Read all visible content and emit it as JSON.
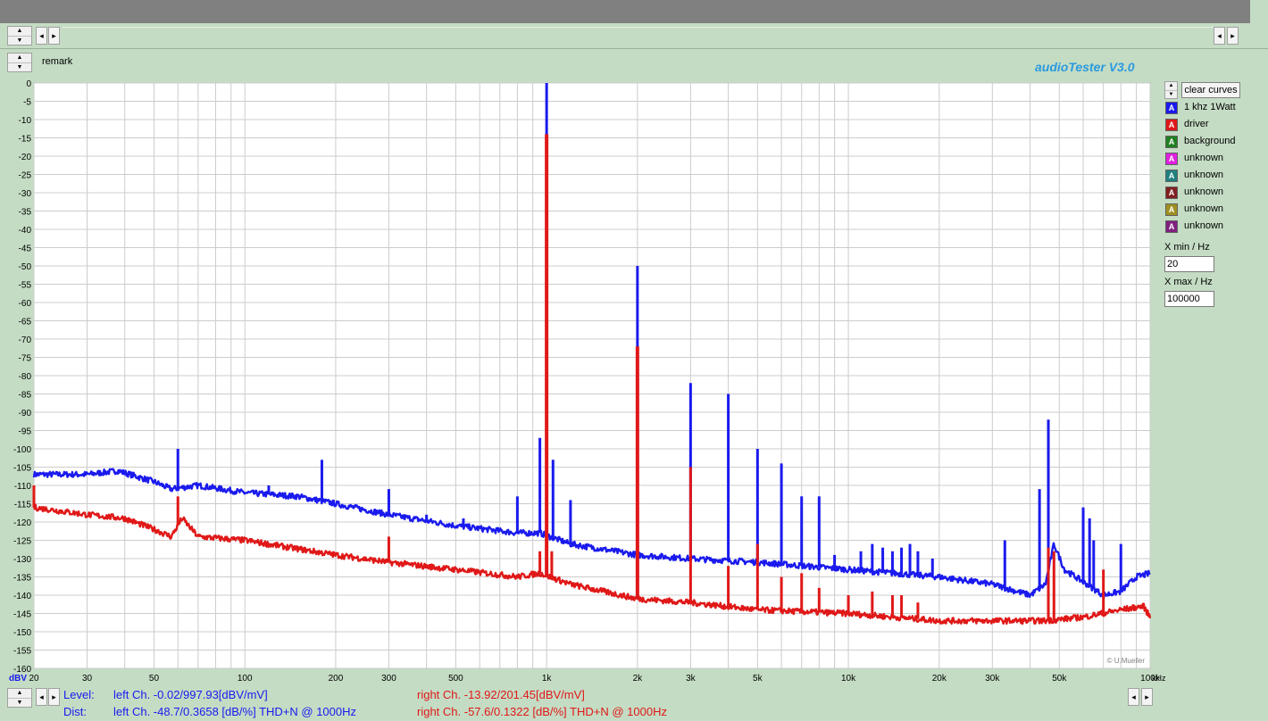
{
  "app": {
    "title": "audioTester  V3.0",
    "remark_label": "remark",
    "copyright": "© U.Mueller"
  },
  "controls": {
    "clear_label": "clear curves",
    "xmin_label": "X min / Hz",
    "xmin_value": "20",
    "xmax_label": "X max / Hz",
    "xmax_value": "100000"
  },
  "legend": [
    {
      "name": "1 khz 1Watt",
      "color": "#1a1aee"
    },
    {
      "name": "driver",
      "color": "#e01818"
    },
    {
      "name": "background",
      "color": "#208020"
    },
    {
      "name": "unknown",
      "color": "#e020e0"
    },
    {
      "name": "unknown",
      "color": "#208080"
    },
    {
      "name": "unknown",
      "color": "#802020"
    },
    {
      "name": "unknown",
      "color": "#a09020"
    },
    {
      "name": "unknown",
      "color": "#802080"
    }
  ],
  "status": {
    "level_label": "Level:",
    "level_left": "left Ch. -0.02/997.93[dBV/mV]",
    "level_right": "right Ch. -13.92/201.45[dBV/mV]",
    "dist_label": "Dist:",
    "dist_left": "left Ch. -48.7/0.3658 [dB/%] THD+N  @ 1000Hz",
    "dist_right": "right Ch. -57.6/0.1322 [dB/%] THD+N  @ 1000Hz"
  },
  "chart_data": {
    "type": "line",
    "x_scale": "log",
    "xlim": [
      20,
      100000
    ],
    "ylim": [
      -160,
      0
    ],
    "grid": true,
    "ylabel": "dBV",
    "xlabel": "kHz",
    "y_ticks": [
      "0",
      "-5",
      "-10",
      "-15",
      "-20",
      "-25",
      "-30",
      "-35",
      "-40",
      "-45",
      "-50",
      "-55",
      "-60",
      "-65",
      "-70",
      "-75",
      "-80",
      "-85",
      "-90",
      "-95",
      "-100",
      "-105",
      "-110",
      "-115",
      "-120",
      "-125",
      "-130",
      "-135",
      "-140",
      "-145",
      "-150",
      "-155",
      "-160"
    ],
    "x_ticks": [
      {
        "v": 20,
        "label": "20"
      },
      {
        "v": 30,
        "label": "30"
      },
      {
        "v": 50,
        "label": "50"
      },
      {
        "v": 100,
        "label": "100"
      },
      {
        "v": 200,
        "label": "200"
      },
      {
        "v": 300,
        "label": "300"
      },
      {
        "v": 500,
        "label": "500"
      },
      {
        "v": 1000,
        "label": "1k"
      },
      {
        "v": 2000,
        "label": "2k"
      },
      {
        "v": 3000,
        "label": "3k"
      },
      {
        "v": 5000,
        "label": "5k"
      },
      {
        "v": 10000,
        "label": "10k"
      },
      {
        "v": 20000,
        "label": "20k"
      },
      {
        "v": 30000,
        "label": "30k"
      },
      {
        "v": 50000,
        "label": "50k"
      },
      {
        "v": 100000,
        "label": "100k"
      }
    ],
    "series": [
      {
        "name": "1 khz 1Watt",
        "color": "#1a1aee",
        "baseline": [
          [
            20,
            -107
          ],
          [
            30,
            -107
          ],
          [
            38,
            -106
          ],
          [
            50,
            -109
          ],
          [
            57,
            -111
          ],
          [
            70,
            -110
          ],
          [
            100,
            -112
          ],
          [
            150,
            -113
          ],
          [
            200,
            -115
          ],
          [
            300,
            -118
          ],
          [
            500,
            -121
          ],
          [
            800,
            -123
          ],
          [
            950,
            -123
          ],
          [
            1200,
            -126
          ],
          [
            2000,
            -129
          ],
          [
            3000,
            -130
          ],
          [
            5000,
            -131
          ],
          [
            10000,
            -133
          ],
          [
            20000,
            -135
          ],
          [
            30000,
            -137
          ],
          [
            40000,
            -140
          ],
          [
            45000,
            -137
          ],
          [
            48000,
            -126
          ],
          [
            52000,
            -133
          ],
          [
            70000,
            -140
          ],
          [
            80000,
            -139
          ],
          [
            90000,
            -135
          ],
          [
            100000,
            -134
          ]
        ],
        "peaks": [
          [
            60,
            -100
          ],
          [
            120,
            -110
          ],
          [
            180,
            -103
          ],
          [
            300,
            -111
          ],
          [
            400,
            -118
          ],
          [
            530,
            -119
          ],
          [
            800,
            -113
          ],
          [
            950,
            -97
          ],
          [
            1000,
            0
          ],
          [
            1050,
            -103
          ],
          [
            1200,
            -114
          ],
          [
            2000,
            -50
          ],
          [
            3000,
            -82
          ],
          [
            4000,
            -85
          ],
          [
            5000,
            -100
          ],
          [
            6000,
            -104
          ],
          [
            7000,
            -113
          ],
          [
            8000,
            -113
          ],
          [
            9000,
            -129
          ],
          [
            11000,
            -128
          ],
          [
            12000,
            -126
          ],
          [
            13000,
            -127
          ],
          [
            14000,
            -128
          ],
          [
            15000,
            -127
          ],
          [
            16000,
            -126
          ],
          [
            17000,
            -128
          ],
          [
            19000,
            -130
          ],
          [
            33000,
            -125
          ],
          [
            43000,
            -111
          ],
          [
            46000,
            -92
          ],
          [
            60000,
            -116
          ],
          [
            63000,
            -119
          ],
          [
            65000,
            -125
          ],
          [
            80000,
            -126
          ]
        ]
      },
      {
        "name": "driver",
        "color": "#e01818",
        "baseline": [
          [
            20,
            -116
          ],
          [
            30,
            -118
          ],
          [
            40,
            -119
          ],
          [
            50,
            -122
          ],
          [
            57,
            -124
          ],
          [
            62,
            -119
          ],
          [
            70,
            -124
          ],
          [
            100,
            -125
          ],
          [
            200,
            -129
          ],
          [
            300,
            -131
          ],
          [
            500,
            -133
          ],
          [
            800,
            -135
          ],
          [
            950,
            -134
          ],
          [
            1200,
            -137
          ],
          [
            2000,
            -141
          ],
          [
            3000,
            -142
          ],
          [
            5000,
            -144
          ],
          [
            10000,
            -145
          ],
          [
            20000,
            -147
          ],
          [
            30000,
            -147
          ],
          [
            45000,
            -147
          ],
          [
            60000,
            -146
          ],
          [
            80000,
            -144
          ],
          [
            95000,
            -143
          ],
          [
            100000,
            -146
          ]
        ],
        "peaks": [
          [
            20,
            -110
          ],
          [
            60,
            -113
          ],
          [
            300,
            -124
          ],
          [
            950,
            -128
          ],
          [
            1000,
            -14
          ],
          [
            1040,
            -128
          ],
          [
            2000,
            -72
          ],
          [
            3000,
            -105
          ],
          [
            4000,
            -132
          ],
          [
            5000,
            -126
          ],
          [
            6000,
            -135
          ],
          [
            7000,
            -134
          ],
          [
            8000,
            -138
          ],
          [
            10000,
            -140
          ],
          [
            12000,
            -139
          ],
          [
            14000,
            -140
          ],
          [
            15000,
            -140
          ],
          [
            17000,
            -142
          ],
          [
            46000,
            -127
          ],
          [
            48000,
            -128
          ],
          [
            70000,
            -133
          ]
        ]
      }
    ]
  }
}
